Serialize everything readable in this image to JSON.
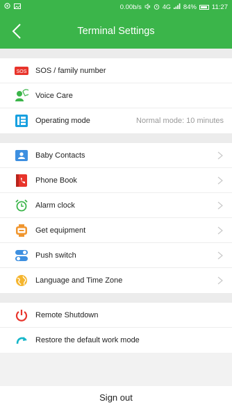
{
  "status_bar": {
    "speed": "0.00b/s",
    "battery": "84%",
    "time": "11:27",
    "signal_label": "4G"
  },
  "nav": {
    "title": "Terminal Settings"
  },
  "groups": [
    [
      {
        "key": "sos",
        "label": "SOS / family number",
        "icon": "sos-icon"
      },
      {
        "key": "voice-care",
        "label": "Voice Care",
        "icon": "person-voice-icon"
      },
      {
        "key": "operating-mode",
        "label": "Operating mode",
        "value": "Normal mode: 10 minutes",
        "icon": "grid-mode-icon"
      }
    ],
    [
      {
        "key": "baby-contacts",
        "label": "Baby Contacts",
        "icon": "contact-card-icon",
        "chevron": true
      },
      {
        "key": "phone-book",
        "label": "Phone Book",
        "icon": "phone-book-icon",
        "chevron": true
      },
      {
        "key": "alarm-clock",
        "label": "Alarm clock",
        "icon": "alarm-clock-icon",
        "chevron": true
      },
      {
        "key": "get-equipment",
        "label": "Get equipment",
        "icon": "watch-icon",
        "chevron": true
      },
      {
        "key": "push-switch",
        "label": "Push switch",
        "icon": "toggle-switch-icon",
        "chevron": true
      },
      {
        "key": "language-time-zone",
        "label": "Language and Time Zone",
        "icon": "globe-icon",
        "chevron": true
      }
    ],
    [
      {
        "key": "remote-shutdown",
        "label": "Remote Shutdown",
        "icon": "power-icon"
      },
      {
        "key": "restore-default",
        "label": "Restore the default work mode",
        "icon": "restore-arrow-icon"
      }
    ]
  ],
  "signout": {
    "label": "Sign out"
  },
  "colors": {
    "primary": "#3bb54a",
    "sos_red": "#e8342b",
    "blue": "#3d8fe0",
    "orange": "#f0962f"
  }
}
